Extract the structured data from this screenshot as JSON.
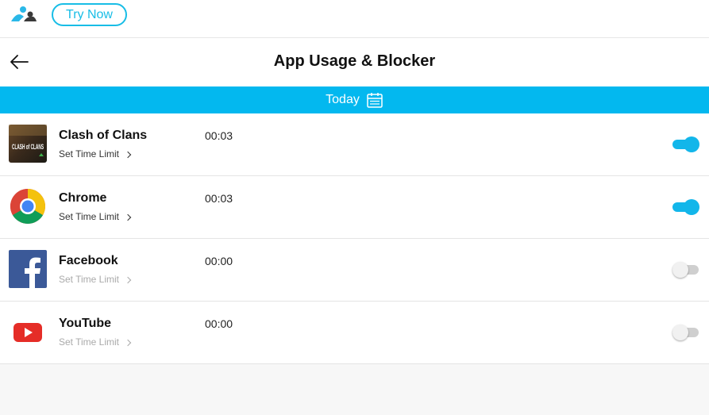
{
  "topbar": {
    "try_now_label": "Try Now"
  },
  "header": {
    "title": "App Usage & Blocker"
  },
  "date_bar": {
    "label": "Today"
  },
  "colors": {
    "accent": "#03b8ef"
  },
  "apps": [
    {
      "name": "Clash of Clans",
      "time": "00:03",
      "limit_label": "Set Time Limit",
      "enabled": true,
      "icon": "clash-of-clans-icon",
      "icon_text": "CLASH of CLANS"
    },
    {
      "name": "Chrome",
      "time": "00:03",
      "limit_label": "Set Time Limit",
      "enabled": true,
      "icon": "chrome-icon"
    },
    {
      "name": "Facebook",
      "time": "00:00",
      "limit_label": "Set Time Limit",
      "enabled": false,
      "icon": "facebook-icon"
    },
    {
      "name": "YouTube",
      "time": "00:00",
      "limit_label": "Set Time Limit",
      "enabled": false,
      "icon": "youtube-icon"
    }
  ]
}
